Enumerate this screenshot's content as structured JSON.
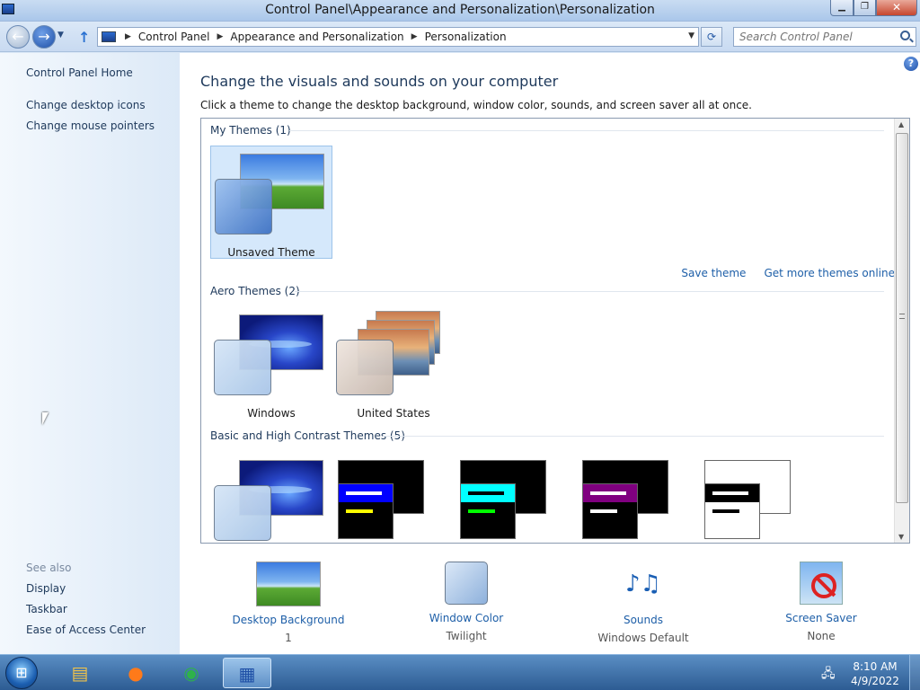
{
  "window": {
    "title": "Control Panel\\Appearance and Personalization\\Personalization",
    "min_glyph": "▁",
    "max_glyph": "❐",
    "close_glyph": "✕"
  },
  "nav": {
    "back_glyph": "←",
    "forward_glyph": "→",
    "history_glyph": "▼",
    "up_glyph": "↑",
    "breadcrumbs": [
      "Control Panel",
      "Appearance and Personalization",
      "Personalization"
    ],
    "crumb_sep": "▶",
    "dropdown_glyph": "▼",
    "refresh_glyph": "⟳",
    "search_placeholder": "Search Control Panel"
  },
  "sidebar": {
    "items": [
      "Control Panel Home",
      "Change desktop icons",
      "Change mouse pointers"
    ],
    "see_also_title": "See also",
    "see_also": [
      "Display",
      "Taskbar",
      "Ease of Access Center"
    ]
  },
  "main": {
    "help_glyph": "?",
    "heading": "Change the visuals and sounds on your computer",
    "description": "Click a theme to change the desktop background, window color, sounds, and screen saver all at once.",
    "sections": [
      {
        "title": "My Themes (1)",
        "themes": [
          "Unsaved Theme"
        ]
      },
      {
        "title": "Aero Themes (2)",
        "themes": [
          "Windows",
          "United States"
        ]
      },
      {
        "title": "Basic and High Contrast Themes (5)",
        "themes": []
      }
    ],
    "save_theme": "Save theme",
    "get_more": "Get more themes online",
    "scroll_up_glyph": "▲",
    "scroll_down_glyph": "▼"
  },
  "bottom": [
    {
      "name": "Desktop Background",
      "value": "1"
    },
    {
      "name": "Window Color",
      "value": "Twilight"
    },
    {
      "name": "Sounds",
      "value": "Windows Default",
      "icon_glyph": "♪♫"
    },
    {
      "name": "Screen Saver",
      "value": "None"
    }
  ],
  "taskbar": {
    "start_glyph": "⊞",
    "apps": [
      {
        "name": "file-explorer-icon",
        "glyph": "▤"
      },
      {
        "name": "firefox-icon",
        "glyph": "●"
      },
      {
        "name": "chrome-icon",
        "glyph": "◉"
      },
      {
        "name": "control-panel-icon",
        "glyph": "▦"
      }
    ],
    "network_glyph": "🖧",
    "time": "8:10 AM",
    "date": "4/9/2022"
  },
  "colors": {
    "accent": "#1e5fa8",
    "heading": "#1e395b",
    "hc_blue": "#0000ff",
    "hc_cyan": "#00ffff",
    "hc_purple": "#800080"
  }
}
